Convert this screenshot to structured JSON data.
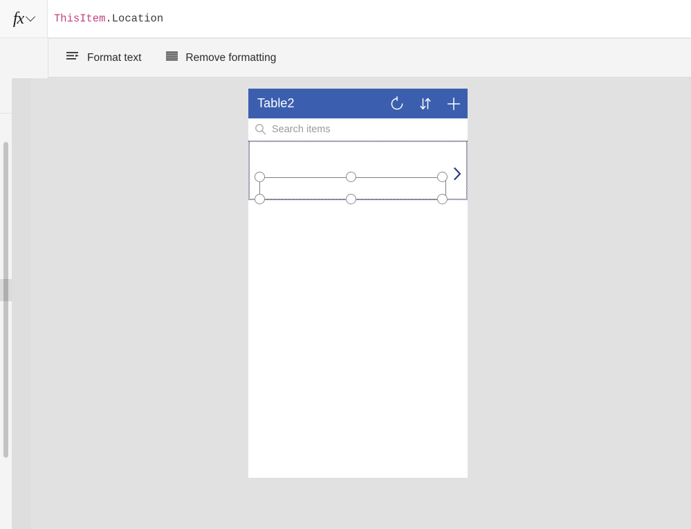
{
  "formula_bar": {
    "fx_label": "fx",
    "fx_icon": "function-icon",
    "chevron_icon": "chevron-down-icon",
    "formula_tokens": {
      "identifier": "ThisItem",
      "dot": ".",
      "property": "Location"
    },
    "full_formula": "ThisItem.Location"
  },
  "toolbar": {
    "format_text_label": "Format text",
    "format_text_icon": "format-text-icon",
    "remove_formatting_label": "Remove formatting",
    "remove_formatting_icon": "remove-formatting-icon"
  },
  "app": {
    "header": {
      "title": "Table2",
      "background_color": "#3b5fae",
      "title_color": "#ffffff",
      "actions": [
        {
          "name": "refresh-icon",
          "label": "Refresh"
        },
        {
          "name": "sort-icon",
          "label": "Sort"
        },
        {
          "name": "add-icon",
          "label": "Add"
        }
      ]
    },
    "search": {
      "placeholder": "Search items",
      "icon": "search-icon"
    },
    "gallery": {
      "selected": true,
      "row_chevron_icon": "chevron-right-icon",
      "chevron_color": "#2a3c7d",
      "selection_border_color": "#2a3c7d",
      "handle_count": 6
    }
  },
  "colors": {
    "canvas_background": "#e1e1e1",
    "app_background": "#ffffff",
    "accent_blue": "#3b5fae",
    "formula_identifier": "#c2417f",
    "formula_text": "#3b3b3b",
    "placeholder_text": "#9a9a9a"
  }
}
